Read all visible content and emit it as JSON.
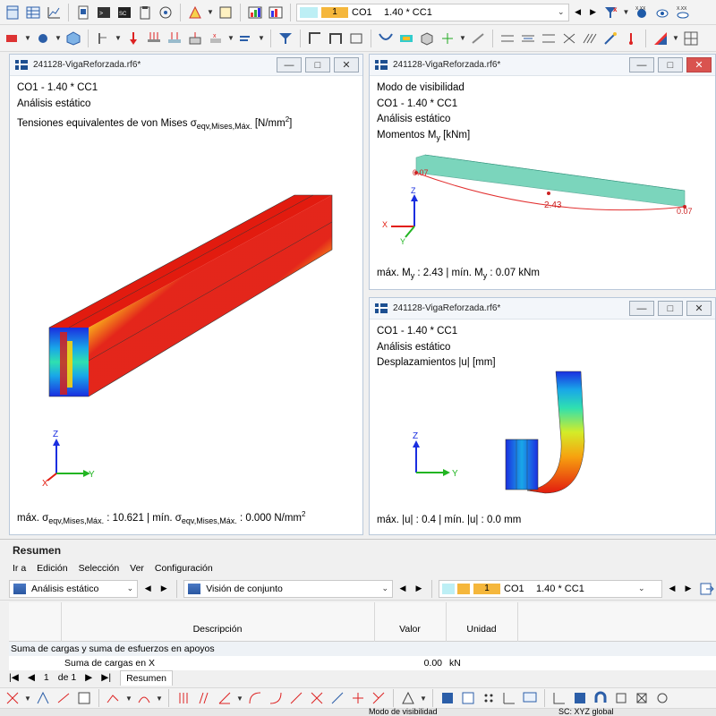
{
  "toolbar": {
    "loadcase_num": "1",
    "loadcase_name": "CO1",
    "loadcase_desc": "1.40 * CC1",
    "swatch_color": "#bdeff5"
  },
  "windows": [
    {
      "title": "241128-VigaReforzada.rf6*",
      "lines": [
        "CO1 - 1.40 * CC1",
        "Análisis estático"
      ],
      "result_label": "Tensiones equivalentes de von Mises σ",
      "result_sub": "eqv,Mises,Máx.",
      "result_unit": "[N/mm",
      "result_unit_sup": "2",
      "result_unit_end": "]",
      "footer": {
        "max_label": "máx. σ",
        "max_sub": "eqv,Mises,Máx.",
        "max_val": ": 10.621 | mín. σ",
        "min_sub": "eqv,Mises,Máx.",
        "min_val": ": 0.000 N/mm",
        "unit_sup": "2"
      },
      "axes": {
        "z": "Z",
        "y": "Y",
        "x": "X"
      }
    },
    {
      "title": "241128-VigaReforzada.rf6*",
      "lines": [
        "Modo de visibilidad",
        "CO1 - 1.40 * CC1",
        "Análisis estático"
      ],
      "result_label": "Momentos M",
      "result_sub": "y",
      "result_unit": " [kNm]",
      "labels": {
        "left": "0.07",
        "mid": "2.43",
        "right": "0.07"
      },
      "footer": {
        "max_label": "máx. M",
        "max_sub": "y",
        "max_val": " : 2.43 | mín. M",
        "min_sub": "y",
        "min_val": " : 0.07 kNm"
      },
      "axes": {
        "z": "Z",
        "y": "Y",
        "x": "X"
      }
    },
    {
      "title": "241128-VigaReforzada.rf6*",
      "lines": [
        "CO1 - 1.40 * CC1",
        "Análisis estático",
        "Desplazamientos |u| [mm]"
      ],
      "footer": "máx. |u| : 0.4 | mín. |u| : 0.0 mm",
      "axes": {
        "z": "Z",
        "y": "Y"
      }
    }
  ],
  "resumen": {
    "title": "Resumen",
    "menu": [
      "Ir a",
      "Edición",
      "Selección",
      "Ver",
      "Configuración"
    ],
    "analysis": "Análisis estático",
    "overview": "Visión de conjunto",
    "columns": {
      "desc": "Descripción",
      "value": "Valor",
      "unit": "Unidad"
    },
    "group": "Suma de cargas y suma de esfuerzos en apoyos",
    "row": {
      "desc": "Suma de cargas en X",
      "value": "0.00",
      "unit": "kN"
    },
    "pager": {
      "page": "1",
      "of": "de 1",
      "tab": "Resumen"
    }
  },
  "status": {
    "mode": "Modo de visibilidad",
    "cs": "SC: XYZ global"
  }
}
